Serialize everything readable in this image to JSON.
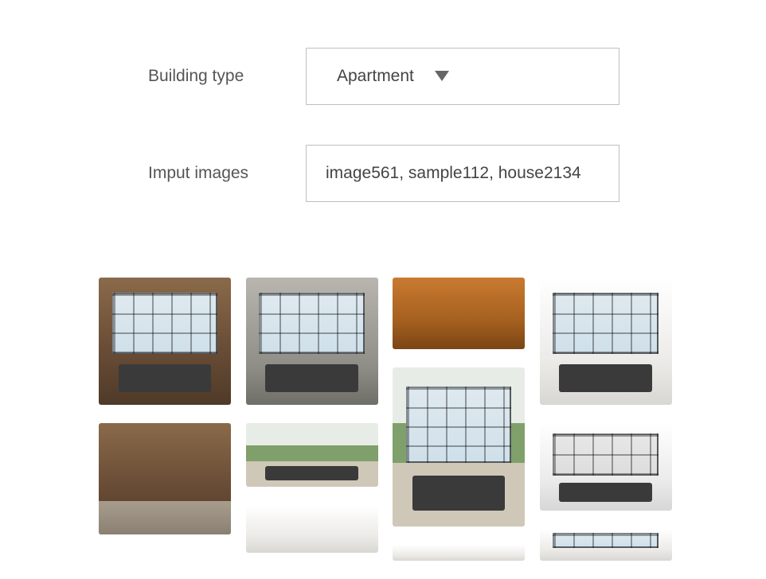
{
  "form": {
    "building_type": {
      "label": "Building type",
      "value": "Apartment"
    },
    "input_images": {
      "label": "Imput images",
      "value": "image561, sample112, house2134"
    }
  }
}
